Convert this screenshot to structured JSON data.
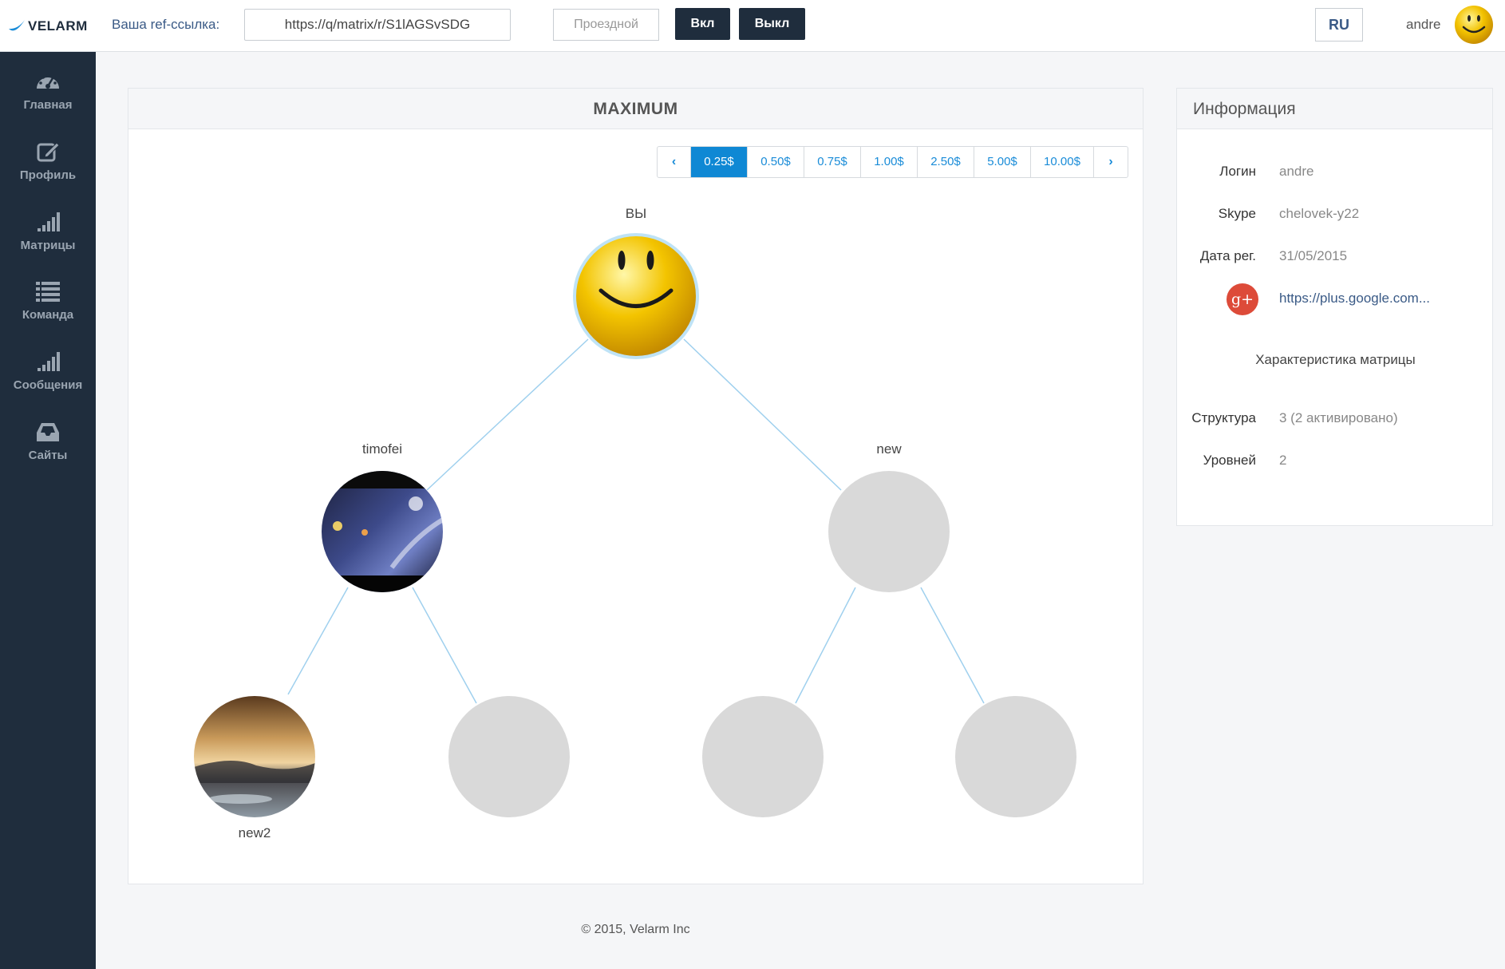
{
  "brand": {
    "name": "VELARM"
  },
  "topbar": {
    "ref_label": "Ваша ref-ссылка:",
    "ref_value": "https://q/matrix/r/S1lAGSvSDG",
    "pass_button": "Проездной",
    "on_button": "Вкл",
    "off_button": "Выкл",
    "lang_button": "RU",
    "username": "andre"
  },
  "sidebar": {
    "items": [
      {
        "label": "Главная",
        "icon": "dashboard-icon"
      },
      {
        "label": "Профиль",
        "icon": "edit-icon"
      },
      {
        "label": "Матрицы",
        "icon": "signal-bars-icon"
      },
      {
        "label": "Команда",
        "icon": "list-icon"
      },
      {
        "label": "Сообщения",
        "icon": "signal-bars-icon"
      },
      {
        "label": "Сайты",
        "icon": "inbox-icon"
      }
    ]
  },
  "matrix": {
    "title": "MAXIMUM",
    "pager": {
      "prev": "‹",
      "next": "›",
      "values": [
        "0.25$",
        "0.50$",
        "0.75$",
        "1.00$",
        "2.50$",
        "5.00$",
        "10.00$"
      ],
      "active": "0.25$"
    },
    "nodes": {
      "root": "ВЫ",
      "left": "timofei",
      "right": "new",
      "left_left": "new2"
    }
  },
  "info": {
    "title": "Информация",
    "login_label": "Логин",
    "login_value": "andre",
    "skype_label": "Skype",
    "skype_value": "chelovek-y22",
    "reg_label": "Дата рег.",
    "reg_value": "31/05/2015",
    "gplus_icon_text": "g+",
    "gplus_link": "https://plus.google.com...",
    "matrix_subtitle": "Характеристика матрицы",
    "structure_label": "Структура",
    "structure_value": "3 (2 активировано)",
    "levels_label": "Уровней",
    "levels_value": "2"
  },
  "footer": {
    "text": "© 2015, Velarm Inc"
  },
  "colors": {
    "sidebar": "#1f2d3d",
    "accent": "#0f88d4",
    "line": "#9fd0ee",
    "empty_node": "#d9d9d9"
  }
}
